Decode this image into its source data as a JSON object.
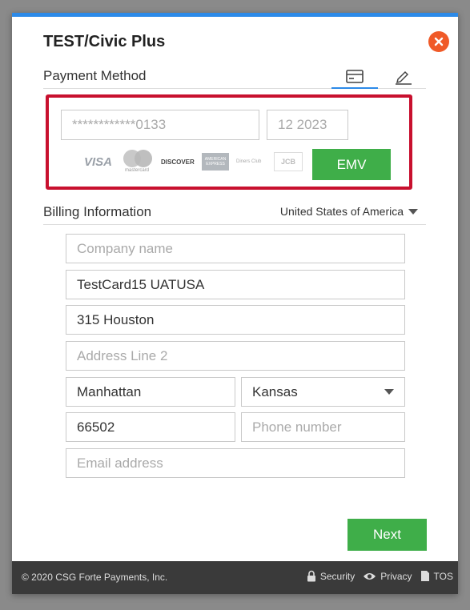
{
  "modal": {
    "title": "TEST/Civic Plus"
  },
  "payment": {
    "heading": "Payment Method",
    "tabs": [
      {
        "icon": "credit-card-icon",
        "active": true
      },
      {
        "icon": "signature-icon",
        "active": false
      }
    ],
    "card_number": "************0133",
    "expiry": "12 2023",
    "brands": [
      "VISA",
      "mastercard",
      "DISCOVER",
      "AMERICAN EXPRESS",
      "Diners Club",
      "JCB"
    ],
    "emv_label": "EMV"
  },
  "billing": {
    "heading": "Billing Information",
    "country": "United States of America",
    "company_placeholder": "Company name",
    "name_value": "TestCard15 UATUSA",
    "address1_value": "315 Houston",
    "address2_placeholder": "Address Line 2",
    "city_value": "Manhattan",
    "state_value": "Kansas",
    "zip_value": "66502",
    "phone_placeholder": "Phone number",
    "email_placeholder": "Email address"
  },
  "actions": {
    "next_label": "Next"
  },
  "footer": {
    "copyright": "© 2020 CSG Forte Payments, Inc.",
    "links": [
      "Security",
      "Privacy",
      "TOS"
    ]
  },
  "colors": {
    "accent": "#2c8ae8",
    "button_green": "#3fae49",
    "highlight_red": "#c8102e",
    "close_orange": "#f05a28",
    "footer_bg": "#3a3a3a"
  }
}
